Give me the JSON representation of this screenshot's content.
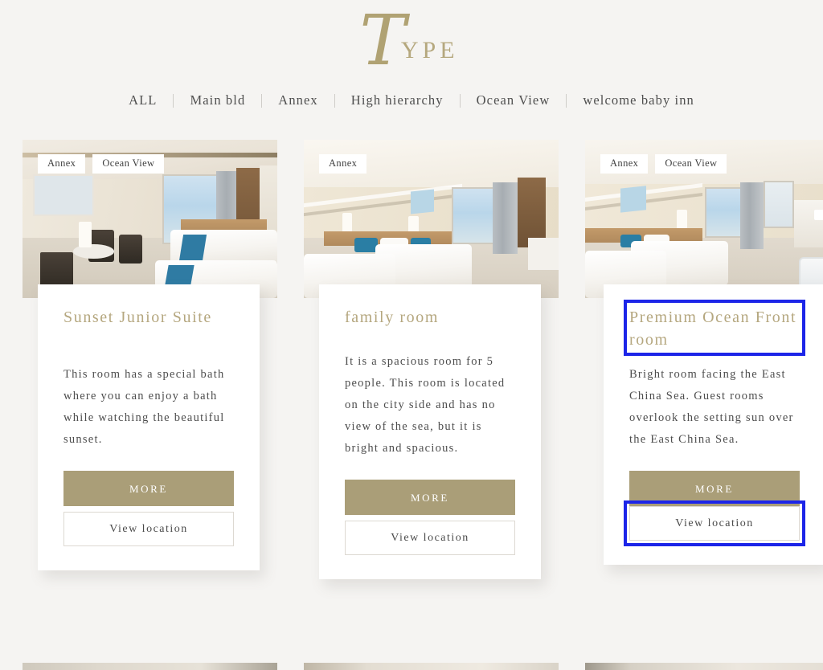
{
  "header": {
    "logo_script_letter": "T",
    "logo_rest": "YPE"
  },
  "filters": [
    {
      "label": "ALL"
    },
    {
      "label": "Main bld"
    },
    {
      "label": "Annex"
    },
    {
      "label": "High hierarchy"
    },
    {
      "label": "Ocean View"
    },
    {
      "label": "welcome baby inn"
    }
  ],
  "colors": {
    "background": "#f5f4f2",
    "title_gold": "#b5a77f",
    "more_button": "#aa9e78",
    "highlight_blue": "#1c25e8",
    "body_text": "#4d4d4d",
    "tag_background": "#ffffff"
  },
  "cards": [
    {
      "tags": [
        "Annex",
        "Ocean View"
      ],
      "title": "Sunset Junior Suite",
      "description": "This room has a special bath where you can enjoy a bath while watching the beautiful sunset.",
      "more_label": "MORE",
      "location_label": "View location",
      "title_highlighted": false,
      "location_highlighted": false
    },
    {
      "tags": [
        "Annex"
      ],
      "title": "family room",
      "description": "It is a spacious room for 5 people. This room is located on the city side and has no view of the sea, but it is bright and spacious.",
      "more_label": "MORE",
      "location_label": "View location",
      "title_highlighted": false,
      "location_highlighted": false
    },
    {
      "tags": [
        "Annex",
        "Ocean View"
      ],
      "title": "Premium Ocean Front room",
      "description": "Bright room facing the East China Sea. Guest rooms overlook the setting sun over the East China Sea.",
      "more_label": "MORE",
      "location_label": "View location",
      "title_highlighted": true,
      "location_highlighted": true
    }
  ]
}
